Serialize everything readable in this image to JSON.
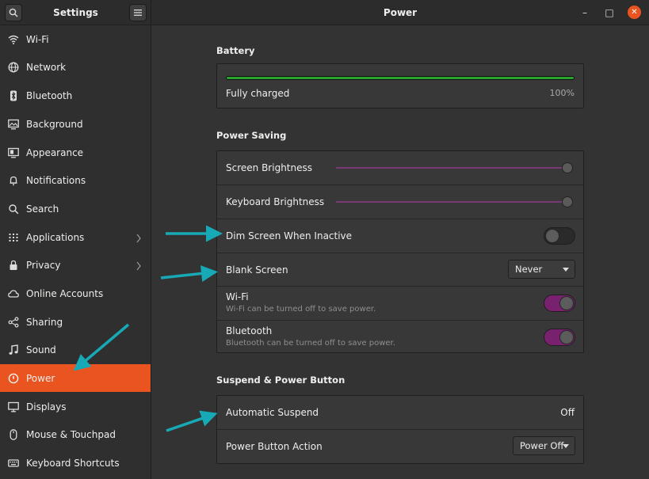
{
  "window": {
    "sidebar_title": "Settings",
    "page_title": "Power",
    "controls": {
      "minimize": "–",
      "maximize": "□",
      "close": "✕"
    }
  },
  "sidebar": {
    "items": [
      {
        "label": "Wi-Fi",
        "icon": "wifi-icon"
      },
      {
        "label": "Network",
        "icon": "network-icon"
      },
      {
        "label": "Bluetooth",
        "icon": "bluetooth-icon"
      },
      {
        "label": "Background",
        "icon": "background-icon"
      },
      {
        "label": "Appearance",
        "icon": "appearance-icon"
      },
      {
        "label": "Notifications",
        "icon": "bell-icon"
      },
      {
        "label": "Search",
        "icon": "search-icon"
      },
      {
        "label": "Applications",
        "icon": "grid-icon",
        "has_submenu": true
      },
      {
        "label": "Privacy",
        "icon": "lock-icon",
        "has_submenu": true
      },
      {
        "label": "Online Accounts",
        "icon": "cloud-icon"
      },
      {
        "label": "Sharing",
        "icon": "share-icon"
      },
      {
        "label": "Sound",
        "icon": "music-note-icon"
      },
      {
        "label": "Power",
        "icon": "power-icon",
        "active": true
      },
      {
        "label": "Displays",
        "icon": "display-icon"
      },
      {
        "label": "Mouse & Touchpad",
        "icon": "mouse-icon"
      },
      {
        "label": "Keyboard Shortcuts",
        "icon": "keyboard-icon"
      }
    ]
  },
  "battery": {
    "title": "Battery",
    "status": "Fully charged",
    "percent_label": "100%",
    "level": 1.0
  },
  "power_saving": {
    "title": "Power Saving",
    "screen_brightness": {
      "label": "Screen Brightness",
      "level": 1.0
    },
    "keyboard_brightness": {
      "label": "Keyboard Brightness",
      "level": 1.0
    },
    "dim_screen": {
      "label": "Dim Screen When Inactive",
      "on": false
    },
    "blank_screen": {
      "label": "Blank Screen",
      "value": "Never"
    },
    "wifi": {
      "label": "Wi-Fi",
      "sub": "Wi-Fi can be turned off to save power.",
      "on": true
    },
    "bluetooth": {
      "label": "Bluetooth",
      "sub": "Bluetooth can be turned off to save power.",
      "on": true
    }
  },
  "suspend": {
    "title": "Suspend & Power Button",
    "automatic_suspend": {
      "label": "Automatic Suspend",
      "value": "Off"
    },
    "power_button": {
      "label": "Power Button Action",
      "value": "Power Off"
    }
  },
  "colors": {
    "accent": "#e95420",
    "toggle_on": "#77216f",
    "battery": "#2aa42a",
    "annotation_arrow": "#17a9b5"
  }
}
